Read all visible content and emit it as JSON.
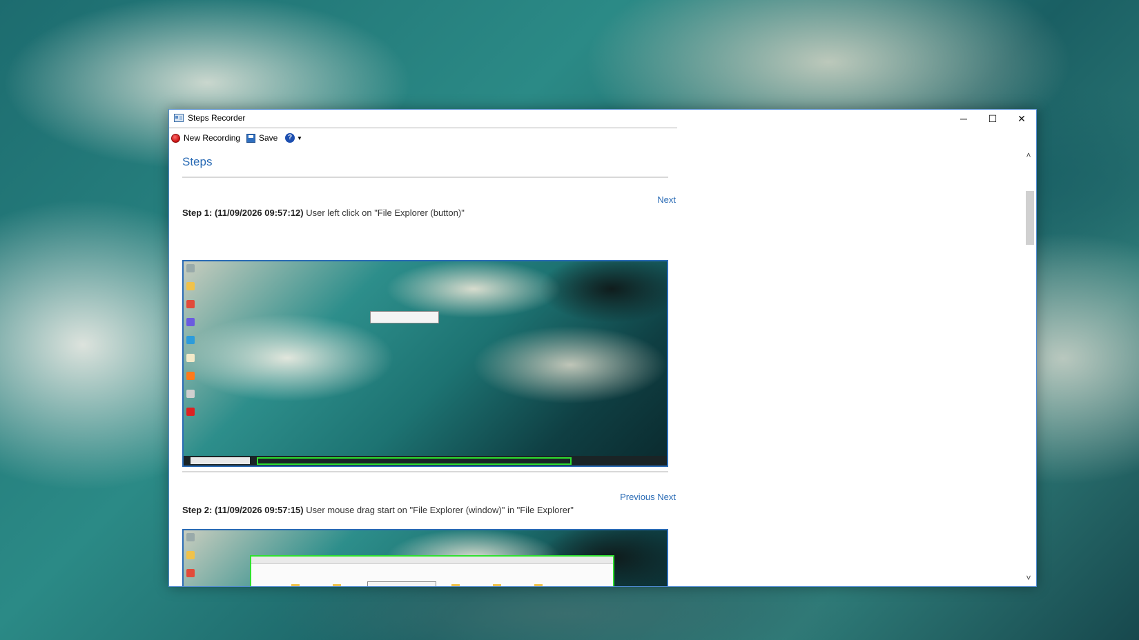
{
  "window": {
    "title": "Steps Recorder",
    "minimize_glyph": "─",
    "maximize_glyph": "☐",
    "close_glyph": "✕"
  },
  "toolbar": {
    "new_recording_label": "New Recording",
    "save_label": "Save",
    "help_glyph": "?",
    "help_caret": "▼"
  },
  "content": {
    "heading": "Steps",
    "steps": [
      {
        "nav": "Next",
        "header": "Step 1: (11/09/2026 09:57:12)",
        "description": " User left click on \"File Explorer (button)\""
      },
      {
        "nav": "Previous Next",
        "header": "Step 2: (11/09/2026 09:57:15)",
        "description": " User mouse drag start on \"File Explorer (window)\" in \"File Explorer\""
      }
    ]
  },
  "scrollbar": {
    "up_glyph": "˄",
    "down_glyph": "˅"
  },
  "icons": {
    "app": "steps-recorder-icon",
    "record": "record-icon",
    "save": "save-icon",
    "help": "help-icon"
  },
  "colors": {
    "link": "#2a6bb5",
    "highlight": "#2fe02f",
    "window_border": "#4f8ad1"
  }
}
